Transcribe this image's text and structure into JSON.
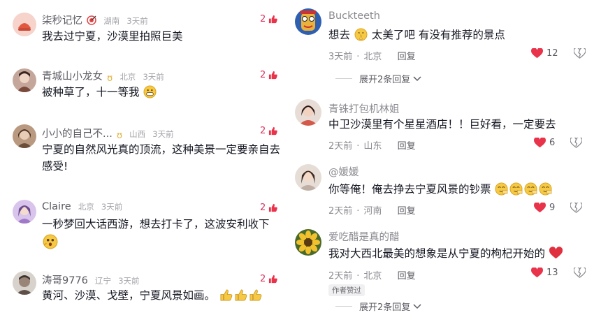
{
  "left_comments": [
    {
      "user": "柒秒记忆",
      "loc": "湖南",
      "time": "3天前",
      "text": "我去过宁夏，沙漠里拍照巨美",
      "likes": "2",
      "avatar_color": "#f4c8c0",
      "avatar_icon": "cake-icon"
    },
    {
      "user": "青城山小龙女",
      "loc": "北京",
      "time": "3天前",
      "text": "被种草了，十一等我",
      "likes": "2",
      "avatar_color": "#b89a8a",
      "avatar_icon": "photo-avatar"
    },
    {
      "user": "小小的自己不...",
      "loc": "山西",
      "time": "3天前",
      "text": "宁夏的自然风光真的顶流，这种美景一定要亲自去",
      "text2": "感受!",
      "likes": "2",
      "avatar_color": "#a88a70",
      "avatar_icon": "photo-avatar"
    },
    {
      "user": "Claire",
      "loc": "北京",
      "time": "3天前",
      "text": "一秒梦回大话西游，想去打卡了，这波安利收下",
      "likes": "2",
      "avatar_color": "#c7b3e0",
      "avatar_icon": "photo-avatar"
    },
    {
      "user": "涛哥9776",
      "loc": "辽宁",
      "time": "3天前",
      "text": "黄河、沙漠、戈壁，宁夏风景如画。",
      "likes": "2",
      "avatar_color": "#8a7d74",
      "avatar_icon": "photo-avatar"
    }
  ],
  "right_comments": [
    {
      "user": "Buckteeth",
      "text": "想去",
      "text_b": "太美了吧 有没有推荐的景点",
      "time": "3天前",
      "loc": "北京",
      "reply": "回复",
      "likes": "12",
      "liked": true,
      "avatar_color": "#2f5fb0",
      "avatar_icon": "cartoon-avatar",
      "expand": "展开2条回复"
    },
    {
      "user": "青铢打包机林姐",
      "text": "中卫沙漠里有个星星酒店！！巨好看，一定要去",
      "time": "2天前",
      "loc": "山东",
      "reply": "回复",
      "likes": "6",
      "liked": true,
      "avatar_color": "#d35a4a",
      "avatar_icon": "photo-avatar"
    },
    {
      "user": "@媛媛",
      "text": "你等俺！俺去挣去宁夏风景的钞票",
      "time": "2天前",
      "loc": "河南",
      "reply": "回复",
      "likes": "9",
      "liked": true,
      "avatar_color": "#c9b8ad",
      "avatar_icon": "photo-avatar"
    },
    {
      "user": "爱吃醋是真的醋",
      "text": "我对大西北最美的想象是从宁夏的枸杞开始的",
      "time": "2天前",
      "loc": "北京",
      "reply": "回复",
      "likes": "13",
      "liked": true,
      "avatar_color": "#e0b030",
      "avatar_icon": "sunflower-avatar",
      "badge": "作者赞过",
      "expand": "展开2条回复"
    }
  ],
  "colors": {
    "like_red": "#e8334a",
    "meta_gray": "#9a9aa0"
  }
}
